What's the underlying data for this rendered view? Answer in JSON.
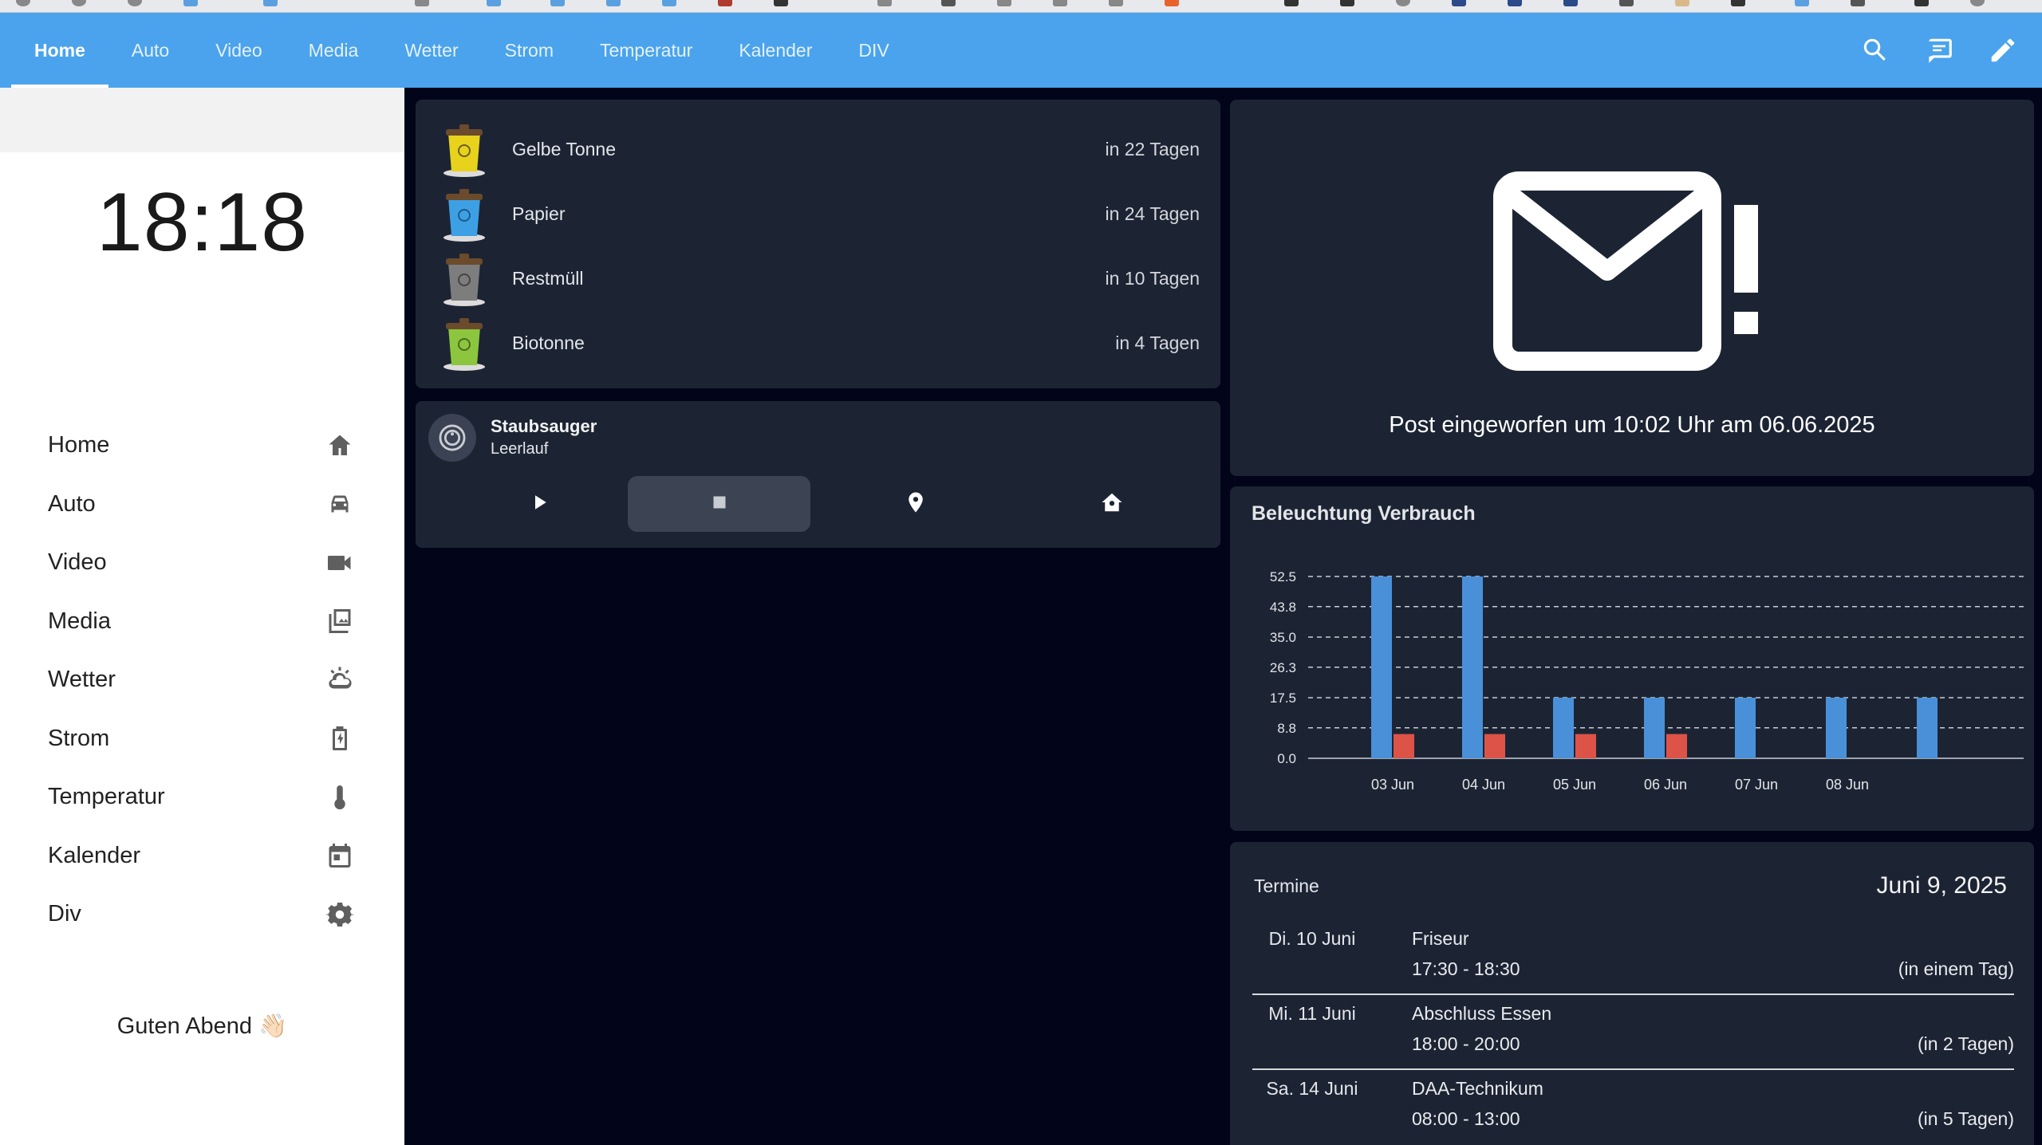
{
  "header": {
    "tabs": [
      {
        "label": "Home",
        "active": true
      },
      {
        "label": "Auto"
      },
      {
        "label": "Video"
      },
      {
        "label": "Media"
      },
      {
        "label": "Wetter"
      },
      {
        "label": "Strom"
      },
      {
        "label": "Temperatur"
      },
      {
        "label": "Kalender"
      },
      {
        "label": "DIV"
      }
    ],
    "actions": [
      "search-icon",
      "chat-icon",
      "pencil-icon"
    ],
    "color": "#4aa3ec"
  },
  "sidebar": {
    "clock": "18:18",
    "items": [
      {
        "label": "Home",
        "icon": "home-icon"
      },
      {
        "label": "Auto",
        "icon": "car-icon"
      },
      {
        "label": "Video",
        "icon": "video-camera-icon"
      },
      {
        "label": "Media",
        "icon": "media-library-icon"
      },
      {
        "label": "Wetter",
        "icon": "weather-icon"
      },
      {
        "label": "Strom",
        "icon": "battery-charging-icon"
      },
      {
        "label": "Temperatur",
        "icon": "thermometer-icon"
      },
      {
        "label": "Kalender",
        "icon": "calendar-icon"
      },
      {
        "label": "Div",
        "icon": "cog-icon"
      }
    ],
    "greeting": "Guten Abend 👋🏻"
  },
  "waste": {
    "items": [
      {
        "name": "Gelbe Tonne",
        "days": "in 22 Tagen",
        "color": "#e8d21c"
      },
      {
        "name": "Papier",
        "days": "in 24 Tagen",
        "color": "#3ea0e4"
      },
      {
        "name": "Restmüll",
        "days": "in 10 Tagen",
        "color": "#7d7d7d"
      },
      {
        "name": "Biotonne",
        "days": "in 4 Tagen",
        "color": "#8cc63f"
      }
    ]
  },
  "vacuum": {
    "name": "Staubsauger",
    "state": "Leerlauf",
    "buttons": [
      "play-icon",
      "stop-icon",
      "map-pin-icon",
      "home-dock-icon"
    ]
  },
  "mail": {
    "text": "Post eingeworfen um 10:02 Uhr am 06.06.2025",
    "icon": "mail-alert-icon"
  },
  "chart_data": {
    "type": "bar",
    "title": "Beleuchtung Verbrauch",
    "categories": [
      "03 Jun",
      "04 Jun",
      "05 Jun",
      "06 Jun",
      "07 Jun",
      "08 Jun",
      ""
    ],
    "series": [
      {
        "color": "#4a90d9",
        "values": [
          52.5,
          52.5,
          17.5,
          17.5,
          17.5,
          17.5,
          17.5
        ]
      },
      {
        "color": "#de5347",
        "values": [
          7.0,
          7.0,
          7.0,
          7.0,
          0,
          0,
          0
        ]
      }
    ],
    "yticks": [
      "0.0",
      "8.8",
      "17.5",
      "26.3",
      "35.0",
      "43.8",
      "52.5"
    ],
    "ylim": [
      0,
      52.5
    ],
    "grid": true
  },
  "calendar": {
    "title": "Termine",
    "date": "Juni 9, 2025",
    "events": [
      {
        "day": "Di. 10 Juni",
        "title": "Friseur",
        "time": "17:30 - 18:30",
        "rel": "(in einem Tag)"
      },
      {
        "day": "Mi. 11 Juni",
        "title": "Abschluss Essen",
        "time": "18:00 - 20:00",
        "rel": "(in 2 Tagen)"
      },
      {
        "day": "Sa. 14 Juni",
        "title": "DAA-Technikum",
        "time": "08:00 - 13:00",
        "rel": "(in 5 Tagen)"
      }
    ]
  }
}
